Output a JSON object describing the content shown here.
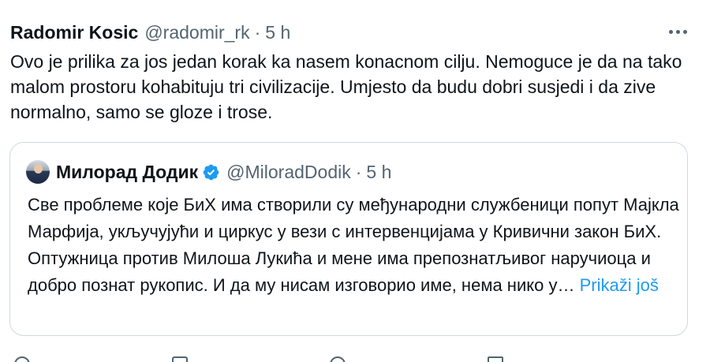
{
  "tweet": {
    "author_name": "Radomir Kosic",
    "author_handle": "@radomir_rk",
    "separator": "·",
    "time": "5 h",
    "more_icon": "more-horizontal-icon",
    "text": "Ovo je prilika za jos jedan korak ka nasem konacnom cilju. Nemoguce je da na tako malom prostoru kohabituju tri civilizacije. Umjesto da budu dobri susjedi i da zive normalno, samo se gloze i trose."
  },
  "quote": {
    "author_name": "Милорад Додик",
    "verified_icon": "verified-badge-icon",
    "verified_color": "#1d9bf0",
    "author_handle": "@MiloradDodik",
    "separator": "·",
    "time": "5 h",
    "text": "Све проблеме које БиХ има створили су међународни службеници попут Мајкла Марфија, укључујући и циркус у вези с интервенцијама у Кривични закон БиХ. Оптужница против Милоша Лукића и мене има препознатљивог наручиоца и добро познат рукопис. И да му нисам изговорио име, нема нико у…",
    "show_more": "Prikaži još"
  },
  "actions": {
    "icons": [
      "reply-icon",
      "retweet-icon",
      "like-icon",
      "views-icon"
    ]
  }
}
